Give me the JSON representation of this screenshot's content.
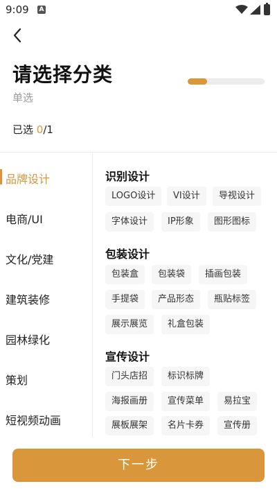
{
  "status": {
    "time": "9:09",
    "notification": "A"
  },
  "header": {
    "title": "请选择分类",
    "subtitle": "单选",
    "progress": 0.25,
    "selected_label": "已选 ",
    "selected_count": "0",
    "selected_total": "/1"
  },
  "sidebar": {
    "items": [
      {
        "label": "品牌设计",
        "active": true
      },
      {
        "label": "电商/UI"
      },
      {
        "label": "文化/党建"
      },
      {
        "label": "建筑装修"
      },
      {
        "label": "园林绿化"
      },
      {
        "label": "策划"
      },
      {
        "label": "短视频动画"
      }
    ]
  },
  "groups": [
    {
      "title": "识别设计",
      "chips": [
        "LOGO设计",
        "VI设计",
        "导视设计",
        "字体设计",
        "IP形象",
        "图形图标"
      ]
    },
    {
      "title": "包装设计",
      "chips": [
        "包装盒",
        "包装袋",
        "插画包装",
        "手提袋",
        "产品形态",
        "瓶贴标签",
        "展示展览",
        "礼盒包装"
      ]
    },
    {
      "title": "宣传设计",
      "chips": [
        "门头店招",
        "标识标牌",
        "海报画册",
        "宣传菜单",
        "易拉宝",
        "展板展架",
        "名片卡券",
        "宣传册"
      ]
    }
  ],
  "footer": {
    "next_label": "下一步"
  },
  "colors": {
    "accent": "#d9963a"
  }
}
